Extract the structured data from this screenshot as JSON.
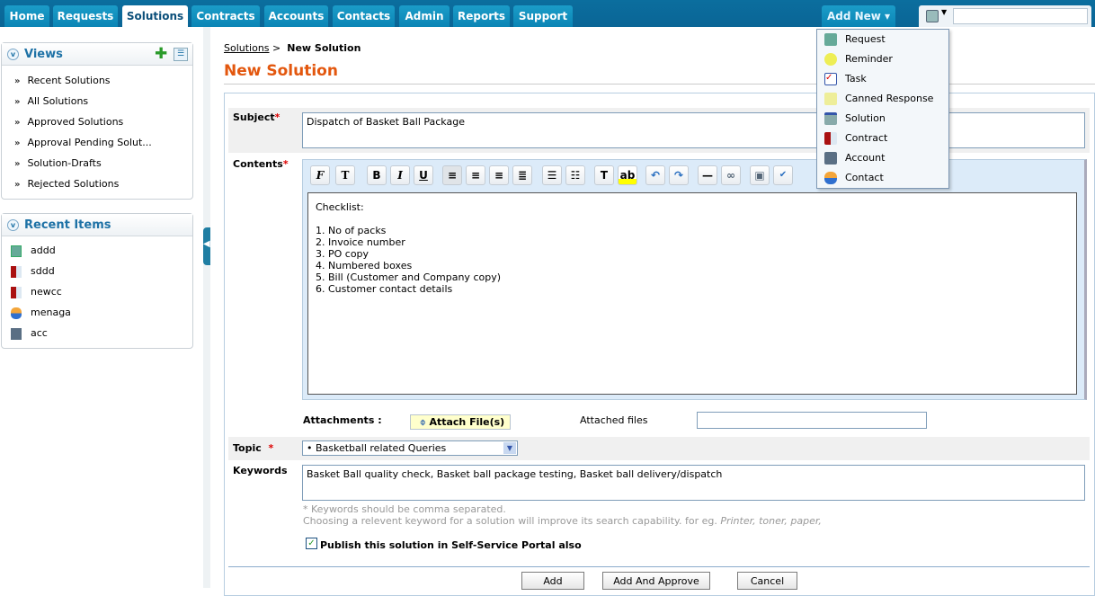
{
  "nav": {
    "tabs": [
      "Home",
      "Requests",
      "Solutions",
      "Contracts",
      "Accounts",
      "Contacts",
      "Admin",
      "Reports",
      "Support"
    ],
    "active": "Solutions",
    "add_new": "Add New ▾",
    "search_placeholder": ""
  },
  "add_new_menu": [
    "Request",
    "Reminder",
    "Task",
    "Canned Response",
    "Solution",
    "Contract",
    "Account",
    "Contact"
  ],
  "views": {
    "title": "Views",
    "items": [
      "Recent Solutions",
      "All Solutions",
      "Approved Solutions",
      "Approval Pending Solut...",
      "Solution-Drafts",
      "Rejected Solutions"
    ]
  },
  "recent": {
    "title": "Recent Items",
    "items": [
      {
        "label": "addd",
        "icon": "request-icon"
      },
      {
        "label": "sddd",
        "icon": "contract-icon"
      },
      {
        "label": "newcc",
        "icon": "contract-icon"
      },
      {
        "label": "menaga",
        "icon": "contact-icon"
      },
      {
        "label": "acc",
        "icon": "account-icon"
      }
    ]
  },
  "breadcrumb": {
    "parent": "Solutions",
    "sep": ">",
    "current": "New Solution"
  },
  "title": "New Solution",
  "form": {
    "subject_label": "Subject",
    "subject_value": "Dispatch of Basket Ball Package",
    "contents_label": "Contents",
    "contents_lines": [
      "Checklist:",
      "",
      "1. No of packs",
      "2. Invoice number",
      "3. PO copy",
      "4. Numbered boxes",
      "5. Bill (Customer and Company copy)",
      "6. Customer contact details"
    ],
    "attachments_label": "Attachments :",
    "attach_button": "Attach File(s)",
    "attached_files_label": "Attached files",
    "topic_label": "Topic",
    "topic_value": "• Basketball related Queries",
    "keywords_label": "Keywords",
    "keywords_value": "Basket Ball quality check, Basket ball package testing, Basket ball delivery/dispatch",
    "hint1": "* Keywords should be comma separated.",
    "hint2": "Choosing a relevent keyword for a solution will improve its search capability. for eg. ",
    "hint2_examples": "Printer, toner, paper,",
    "publish_label": "Publish this solution in Self-Service Portal also",
    "publish_checked": true,
    "required_mark": "*"
  },
  "buttons": {
    "add": "Add",
    "add_approve": "Add And Approve",
    "cancel": "Cancel"
  },
  "colors": {
    "title": "#e3570e",
    "nav": "#0a6596",
    "link": "#1e72a6"
  }
}
